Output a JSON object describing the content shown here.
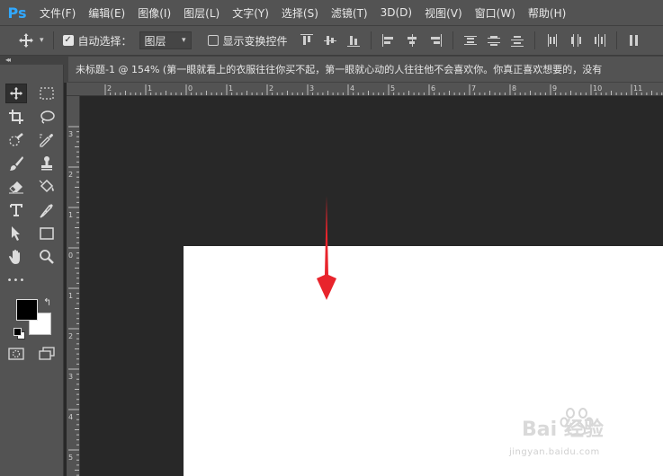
{
  "app": {
    "logo": "Ps"
  },
  "menubar": {
    "items": [
      "文件(F)",
      "编辑(E)",
      "图像(I)",
      "图层(L)",
      "文字(Y)",
      "选择(S)",
      "滤镜(T)",
      "3D(D)",
      "视图(V)",
      "窗口(W)",
      "帮助(H)"
    ]
  },
  "options": {
    "tool_icon": "move-icon",
    "auto_select_label": "自动选择：",
    "auto_select_checked": true,
    "auto_select_target": "图层",
    "show_transform_label": "显示变换控件",
    "show_transform_checked": false
  },
  "document_tab": {
    "title": "未标题-1 @ 154% (第一眼就看上的衣服往往你买不起，第一眼就心动的人往往他不会喜欢你。你真正喜欢想要的，没有"
  },
  "ruler": {
    "top_labels": [
      "2",
      "1",
      "0",
      "1",
      "2",
      "3",
      "4",
      "5",
      "6",
      "7",
      "8",
      "9",
      "10",
      "11"
    ],
    "left_labels": [
      "3",
      "2",
      "1",
      "0",
      "1",
      "2",
      "3",
      "4",
      "5"
    ]
  },
  "toolbar": {
    "collapse_glyph": "◂◂",
    "more_glyph": "•••"
  },
  "colors": {
    "foreground": "#000000",
    "background": "#ffffff",
    "annotation_arrow": "#e8242c"
  },
  "watermark": {
    "text": "Bai 经验",
    "url": "jingyan.baidu.com"
  }
}
